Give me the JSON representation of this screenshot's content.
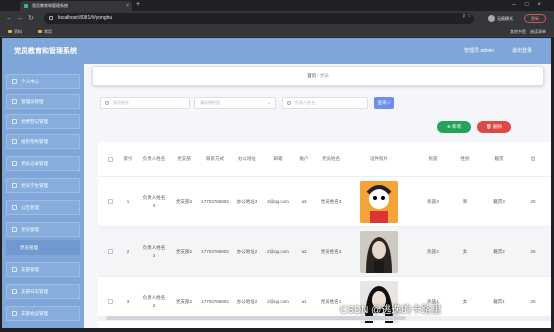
{
  "browser": {
    "tab_title": "党员教育和管理系统",
    "url": "localhost:8081/#/yonghu",
    "profile_label": "无痕模式",
    "update_label": "更新",
    "bookmarks": [
      "资料",
      "常用"
    ],
    "bookmarks_right": [
      "其他书签",
      "阅读清单"
    ]
  },
  "app": {
    "title": "党员教育和管理系统",
    "user_label": "管理员 admin",
    "logout_label": "退出登录"
  },
  "sidebar": {
    "items": [
      {
        "label": "个人中心"
      },
      {
        "label": "管理员管理"
      },
      {
        "label": "党费登记管理"
      },
      {
        "label": "组织架构管理"
      },
      {
        "label": "党员记录管理"
      },
      {
        "label": "党员学生管理"
      },
      {
        "label": "公告管理"
      },
      {
        "label": "党员管理"
      },
      {
        "label": "党员管理"
      },
      {
        "label": "支部管理"
      },
      {
        "label": "支部日志管理"
      },
      {
        "label": "支部会议管理"
      }
    ]
  },
  "breadcrumb": {
    "home": "首页",
    "separator": "/",
    "current": "党员"
  },
  "search": {
    "name_placeholder": "党员姓名",
    "gender_placeholder": "请选择性别",
    "leader_placeholder": "负责人姓名",
    "button_label": "查询"
  },
  "actions": {
    "add_label": "新增",
    "delete_label": "删除"
  },
  "table": {
    "headers": [
      "索引",
      "负责人姓名",
      "党支部",
      "联系方式",
      "办公地址",
      "邮箱",
      "账户",
      "党员姓名",
      "证件照片",
      "民族",
      "性别",
      "籍贯",
      "出"
    ],
    "rows": [
      {
        "index": "1",
        "leader": "负责人姓名3",
        "branch": "党支部3",
        "phone": "17703786903",
        "office": "办公地址3",
        "email": "3@qq.com",
        "account": "a3",
        "member": "党员姓名3",
        "nation": "民族3",
        "gender": "男",
        "origin": "籍贯3",
        "extra": "20"
      },
      {
        "index": "2",
        "leader": "负责人姓名2",
        "branch": "党支部2",
        "phone": "17703786902",
        "office": "办公地址2",
        "email": "2@qq.com",
        "account": "a2",
        "member": "党员姓名2",
        "nation": "民族2",
        "gender": "女",
        "origin": "籍贯2",
        "extra": "20"
      },
      {
        "index": "3",
        "leader": "负责人姓名2",
        "branch": "党支部2",
        "phone": "17703786902",
        "office": "办公地址2",
        "email": "2@qq.com",
        "account": "a1",
        "member": "党员姓名1",
        "nation": "民族1",
        "gender": "女",
        "origin": "籍贯1",
        "extra": "20"
      }
    ]
  },
  "watermark": "CSDN @逃逸的卡路里",
  "colors": {
    "header": "#7ea6d8",
    "add": "#25a35a",
    "delete": "#e04848",
    "search": "#6e8ef0"
  }
}
